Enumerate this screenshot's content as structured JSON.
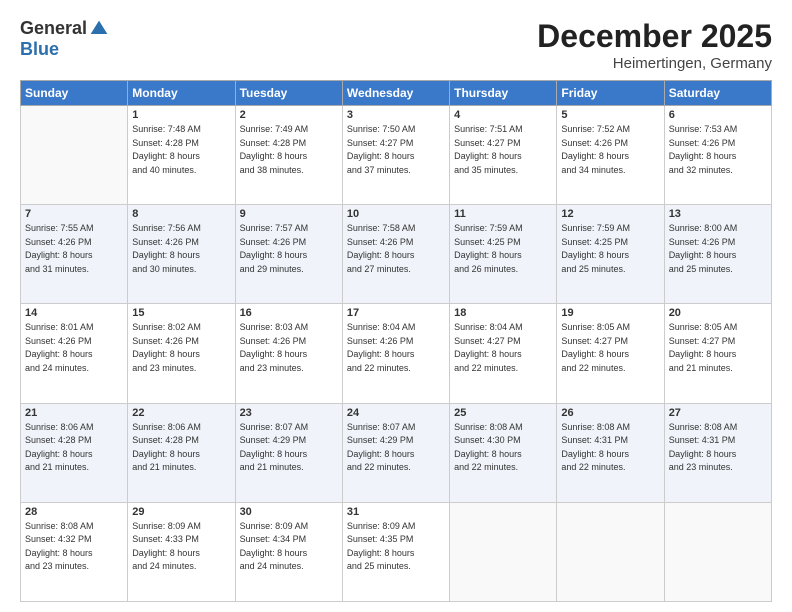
{
  "logo": {
    "general": "General",
    "blue": "Blue"
  },
  "title": "December 2025",
  "location": "Heimertingen, Germany",
  "weekdays": [
    "Sunday",
    "Monday",
    "Tuesday",
    "Wednesday",
    "Thursday",
    "Friday",
    "Saturday"
  ],
  "weeks": [
    [
      {
        "day": "",
        "sunrise": "",
        "sunset": "",
        "daylight": ""
      },
      {
        "day": "1",
        "sunrise": "Sunrise: 7:48 AM",
        "sunset": "Sunset: 4:28 PM",
        "daylight": "Daylight: 8 hours and 40 minutes."
      },
      {
        "day": "2",
        "sunrise": "Sunrise: 7:49 AM",
        "sunset": "Sunset: 4:28 PM",
        "daylight": "Daylight: 8 hours and 38 minutes."
      },
      {
        "day": "3",
        "sunrise": "Sunrise: 7:50 AM",
        "sunset": "Sunset: 4:27 PM",
        "daylight": "Daylight: 8 hours and 37 minutes."
      },
      {
        "day": "4",
        "sunrise": "Sunrise: 7:51 AM",
        "sunset": "Sunset: 4:27 PM",
        "daylight": "Daylight: 8 hours and 35 minutes."
      },
      {
        "day": "5",
        "sunrise": "Sunrise: 7:52 AM",
        "sunset": "Sunset: 4:26 PM",
        "daylight": "Daylight: 8 hours and 34 minutes."
      },
      {
        "day": "6",
        "sunrise": "Sunrise: 7:53 AM",
        "sunset": "Sunset: 4:26 PM",
        "daylight": "Daylight: 8 hours and 32 minutes."
      }
    ],
    [
      {
        "day": "7",
        "sunrise": "Sunrise: 7:55 AM",
        "sunset": "Sunset: 4:26 PM",
        "daylight": "Daylight: 8 hours and 31 minutes."
      },
      {
        "day": "8",
        "sunrise": "Sunrise: 7:56 AM",
        "sunset": "Sunset: 4:26 PM",
        "daylight": "Daylight: 8 hours and 30 minutes."
      },
      {
        "day": "9",
        "sunrise": "Sunrise: 7:57 AM",
        "sunset": "Sunset: 4:26 PM",
        "daylight": "Daylight: 8 hours and 29 minutes."
      },
      {
        "day": "10",
        "sunrise": "Sunrise: 7:58 AM",
        "sunset": "Sunset: 4:26 PM",
        "daylight": "Daylight: 8 hours and 27 minutes."
      },
      {
        "day": "11",
        "sunrise": "Sunrise: 7:59 AM",
        "sunset": "Sunset: 4:25 PM",
        "daylight": "Daylight: 8 hours and 26 minutes."
      },
      {
        "day": "12",
        "sunrise": "Sunrise: 7:59 AM",
        "sunset": "Sunset: 4:25 PM",
        "daylight": "Daylight: 8 hours and 25 minutes."
      },
      {
        "day": "13",
        "sunrise": "Sunrise: 8:00 AM",
        "sunset": "Sunset: 4:26 PM",
        "daylight": "Daylight: 8 hours and 25 minutes."
      }
    ],
    [
      {
        "day": "14",
        "sunrise": "Sunrise: 8:01 AM",
        "sunset": "Sunset: 4:26 PM",
        "daylight": "Daylight: 8 hours and 24 minutes."
      },
      {
        "day": "15",
        "sunrise": "Sunrise: 8:02 AM",
        "sunset": "Sunset: 4:26 PM",
        "daylight": "Daylight: 8 hours and 23 minutes."
      },
      {
        "day": "16",
        "sunrise": "Sunrise: 8:03 AM",
        "sunset": "Sunset: 4:26 PM",
        "daylight": "Daylight: 8 hours and 23 minutes."
      },
      {
        "day": "17",
        "sunrise": "Sunrise: 8:04 AM",
        "sunset": "Sunset: 4:26 PM",
        "daylight": "Daylight: 8 hours and 22 minutes."
      },
      {
        "day": "18",
        "sunrise": "Sunrise: 8:04 AM",
        "sunset": "Sunset: 4:27 PM",
        "daylight": "Daylight: 8 hours and 22 minutes."
      },
      {
        "day": "19",
        "sunrise": "Sunrise: 8:05 AM",
        "sunset": "Sunset: 4:27 PM",
        "daylight": "Daylight: 8 hours and 22 minutes."
      },
      {
        "day": "20",
        "sunrise": "Sunrise: 8:05 AM",
        "sunset": "Sunset: 4:27 PM",
        "daylight": "Daylight: 8 hours and 21 minutes."
      }
    ],
    [
      {
        "day": "21",
        "sunrise": "Sunrise: 8:06 AM",
        "sunset": "Sunset: 4:28 PM",
        "daylight": "Daylight: 8 hours and 21 minutes."
      },
      {
        "day": "22",
        "sunrise": "Sunrise: 8:06 AM",
        "sunset": "Sunset: 4:28 PM",
        "daylight": "Daylight: 8 hours and 21 minutes."
      },
      {
        "day": "23",
        "sunrise": "Sunrise: 8:07 AM",
        "sunset": "Sunset: 4:29 PM",
        "daylight": "Daylight: 8 hours and 21 minutes."
      },
      {
        "day": "24",
        "sunrise": "Sunrise: 8:07 AM",
        "sunset": "Sunset: 4:29 PM",
        "daylight": "Daylight: 8 hours and 22 minutes."
      },
      {
        "day": "25",
        "sunrise": "Sunrise: 8:08 AM",
        "sunset": "Sunset: 4:30 PM",
        "daylight": "Daylight: 8 hours and 22 minutes."
      },
      {
        "day": "26",
        "sunrise": "Sunrise: 8:08 AM",
        "sunset": "Sunset: 4:31 PM",
        "daylight": "Daylight: 8 hours and 22 minutes."
      },
      {
        "day": "27",
        "sunrise": "Sunrise: 8:08 AM",
        "sunset": "Sunset: 4:31 PM",
        "daylight": "Daylight: 8 hours and 23 minutes."
      }
    ],
    [
      {
        "day": "28",
        "sunrise": "Sunrise: 8:08 AM",
        "sunset": "Sunset: 4:32 PM",
        "daylight": "Daylight: 8 hours and 23 minutes."
      },
      {
        "day": "29",
        "sunrise": "Sunrise: 8:09 AM",
        "sunset": "Sunset: 4:33 PM",
        "daylight": "Daylight: 8 hours and 24 minutes."
      },
      {
        "day": "30",
        "sunrise": "Sunrise: 8:09 AM",
        "sunset": "Sunset: 4:34 PM",
        "daylight": "Daylight: 8 hours and 24 minutes."
      },
      {
        "day": "31",
        "sunrise": "Sunrise: 8:09 AM",
        "sunset": "Sunset: 4:35 PM",
        "daylight": "Daylight: 8 hours and 25 minutes."
      },
      {
        "day": "",
        "sunrise": "",
        "sunset": "",
        "daylight": ""
      },
      {
        "day": "",
        "sunrise": "",
        "sunset": "",
        "daylight": ""
      },
      {
        "day": "",
        "sunrise": "",
        "sunset": "",
        "daylight": ""
      }
    ]
  ]
}
